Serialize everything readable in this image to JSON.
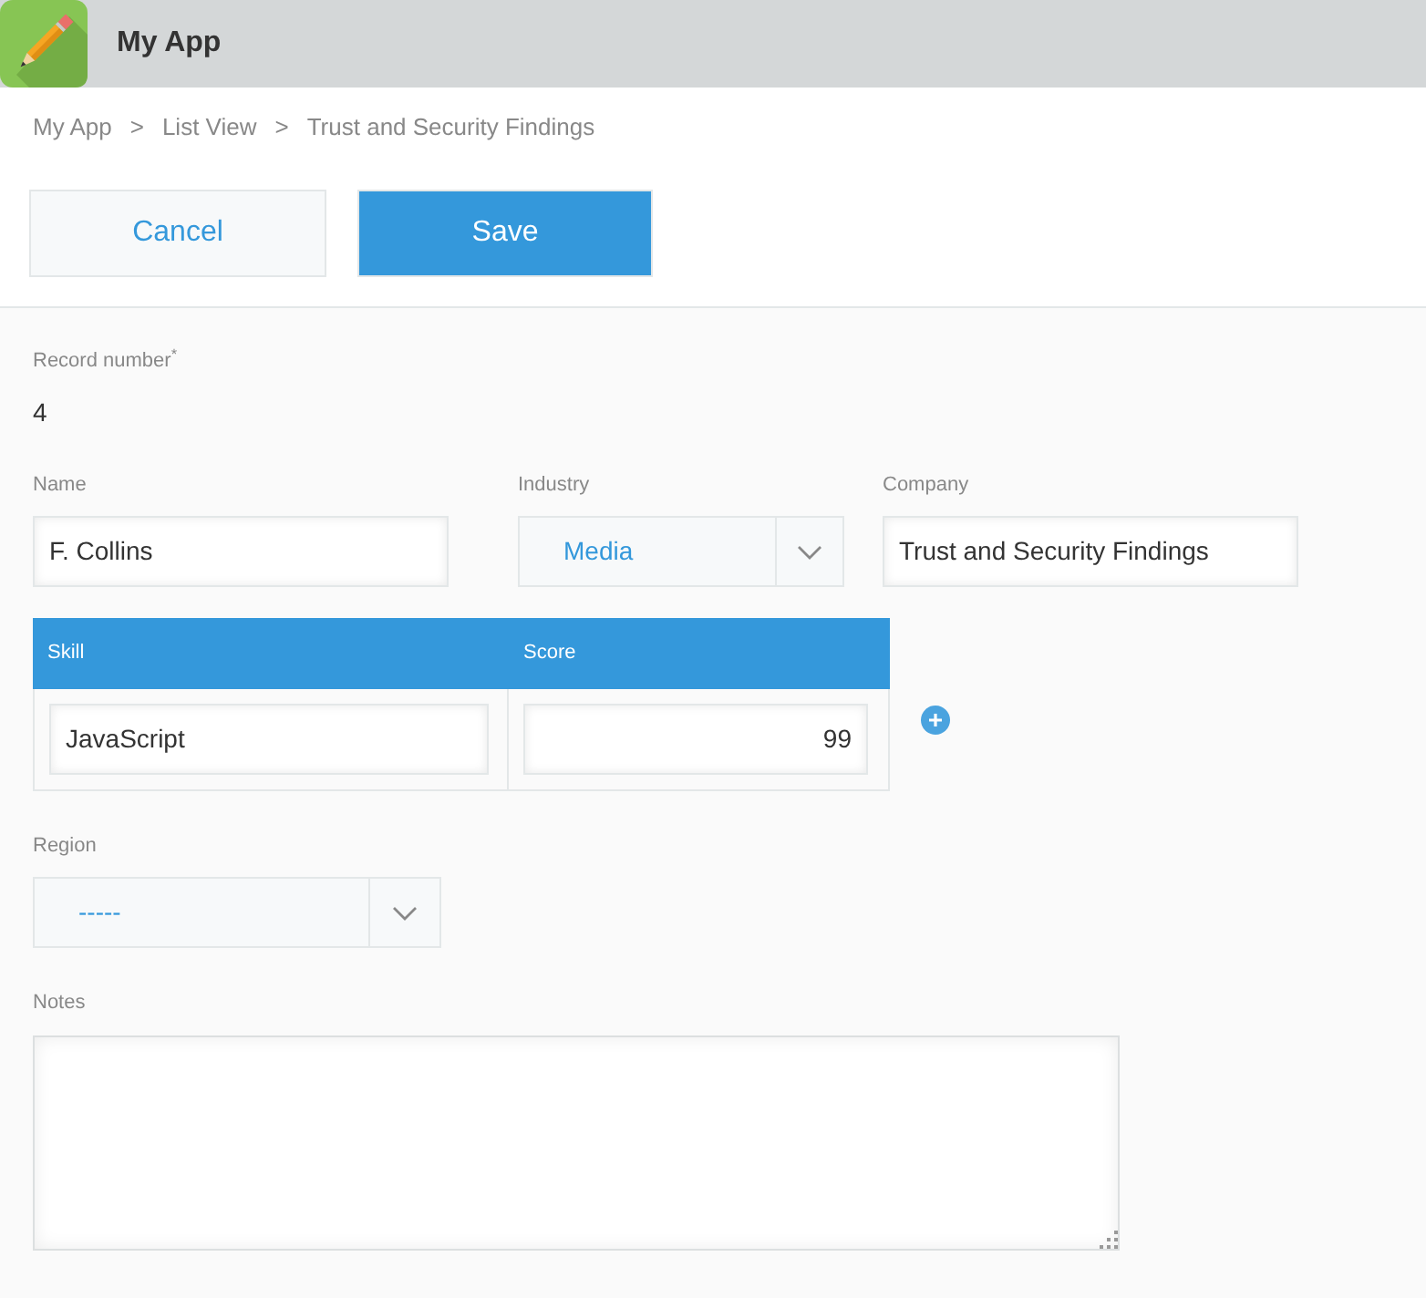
{
  "header": {
    "title": "My App"
  },
  "breadcrumb": [
    {
      "label": "My App",
      "separator": ">"
    },
    {
      "label": "List View",
      "separator": ">"
    },
    {
      "label": "Trust and Security Findings"
    }
  ],
  "buttons": [
    {
      "kind": "secondary",
      "label": "Cancel"
    },
    {
      "kind": "primary",
      "label": "Save"
    }
  ],
  "record_number": {
    "label": "Record number$^{*}$",
    "value": "4"
  },
  "fields": [
    {
      "kind": "text",
      "label": "Name",
      "value": "F. Collins"
    },
    {
      "kind": "dropdown",
      "label": "Industry",
      "value": "Media"
    },
    {
      "kind": "text",
      "label": "Company",
      "value": "Trust and Security Findings"
    }
  ],
  "subtable": {
    "columns": [
      {
        "label": "Skill",
        "kind": "text"
      },
      {
        "label": "Score",
        "kind": "number"
      }
    ],
    "rows": [
      [
        "JavaScript",
        "99"
      ]
    ]
  },
  "region": {
    "label": "Region",
    "value": "-----"
  },
  "notes": {
    "label": "Notes"
  }
}
